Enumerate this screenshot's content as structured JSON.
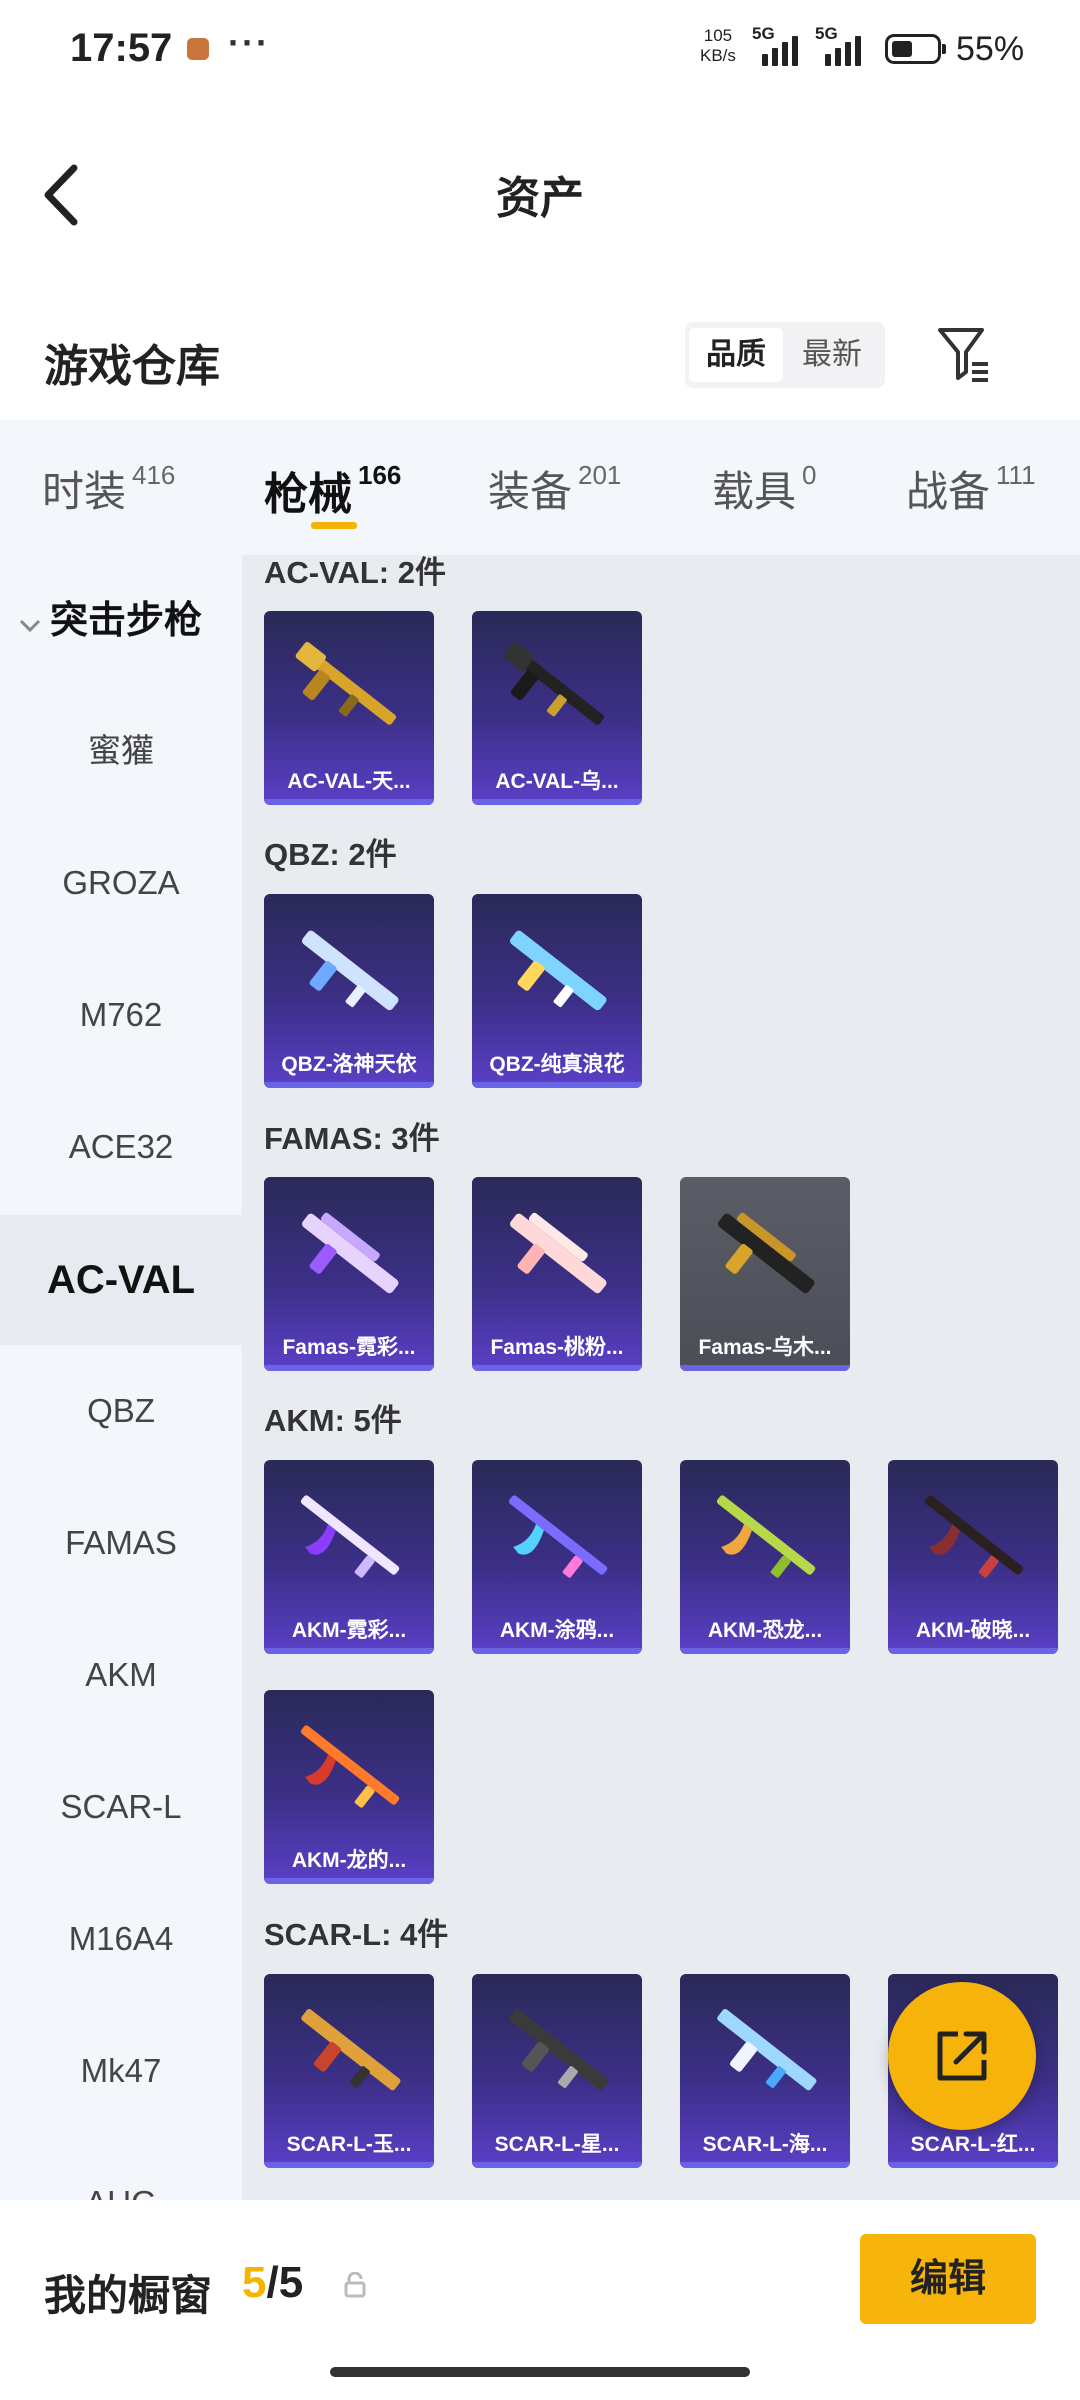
{
  "status_bar": {
    "time": "17:57",
    "speed_value": "105",
    "speed_unit": "KB/s",
    "network_1": "5G",
    "network_2": "5G",
    "battery": "55%"
  },
  "nav": {
    "title": "资产"
  },
  "header": {
    "title": "游戏仓库",
    "sort_options": [
      "品质",
      "最新"
    ]
  },
  "tabs": [
    {
      "label": "时装",
      "count": "416"
    },
    {
      "label": "枪械",
      "count": "166"
    },
    {
      "label": "装备",
      "count": "201"
    },
    {
      "label": "载具",
      "count": "0"
    },
    {
      "label": "战备",
      "count": "111"
    }
  ],
  "sidebar": {
    "category": "突击步枪",
    "items": [
      "蜜獾",
      "GROZA",
      "M762",
      "ACE32",
      "AC-VAL",
      "QBZ",
      "FAMAS",
      "AKM",
      "SCAR-L",
      "M16A4",
      "Mk47",
      "AUG"
    ]
  },
  "sections": [
    {
      "title": "AC-VAL: 2件",
      "items": [
        "AC-VAL-天...",
        "AC-VAL-乌..."
      ]
    },
    {
      "title": "QBZ: 2件",
      "items": [
        "QBZ-洛神天依",
        "QBZ-纯真浪花"
      ]
    },
    {
      "title": "FAMAS: 3件",
      "items": [
        "Famas-霓彩...",
        "Famas-桃粉...",
        "Famas-乌木..."
      ]
    },
    {
      "title": "AKM: 5件",
      "items": [
        "AKM-霓彩...",
        "AKM-涂鸦...",
        "AKM-恐龙...",
        "AKM-破晓...",
        "AKM-龙的..."
      ]
    },
    {
      "title": "SCAR-L: 4件",
      "items": [
        "SCAR-L-玉...",
        "SCAR-L-星...",
        "SCAR-L-海...",
        "SCAR-L-红..."
      ]
    }
  ],
  "bottom": {
    "label": "我的橱窗",
    "count_used": "5",
    "count_sep": "/",
    "count_total": "5",
    "edit_label": "编辑"
  }
}
